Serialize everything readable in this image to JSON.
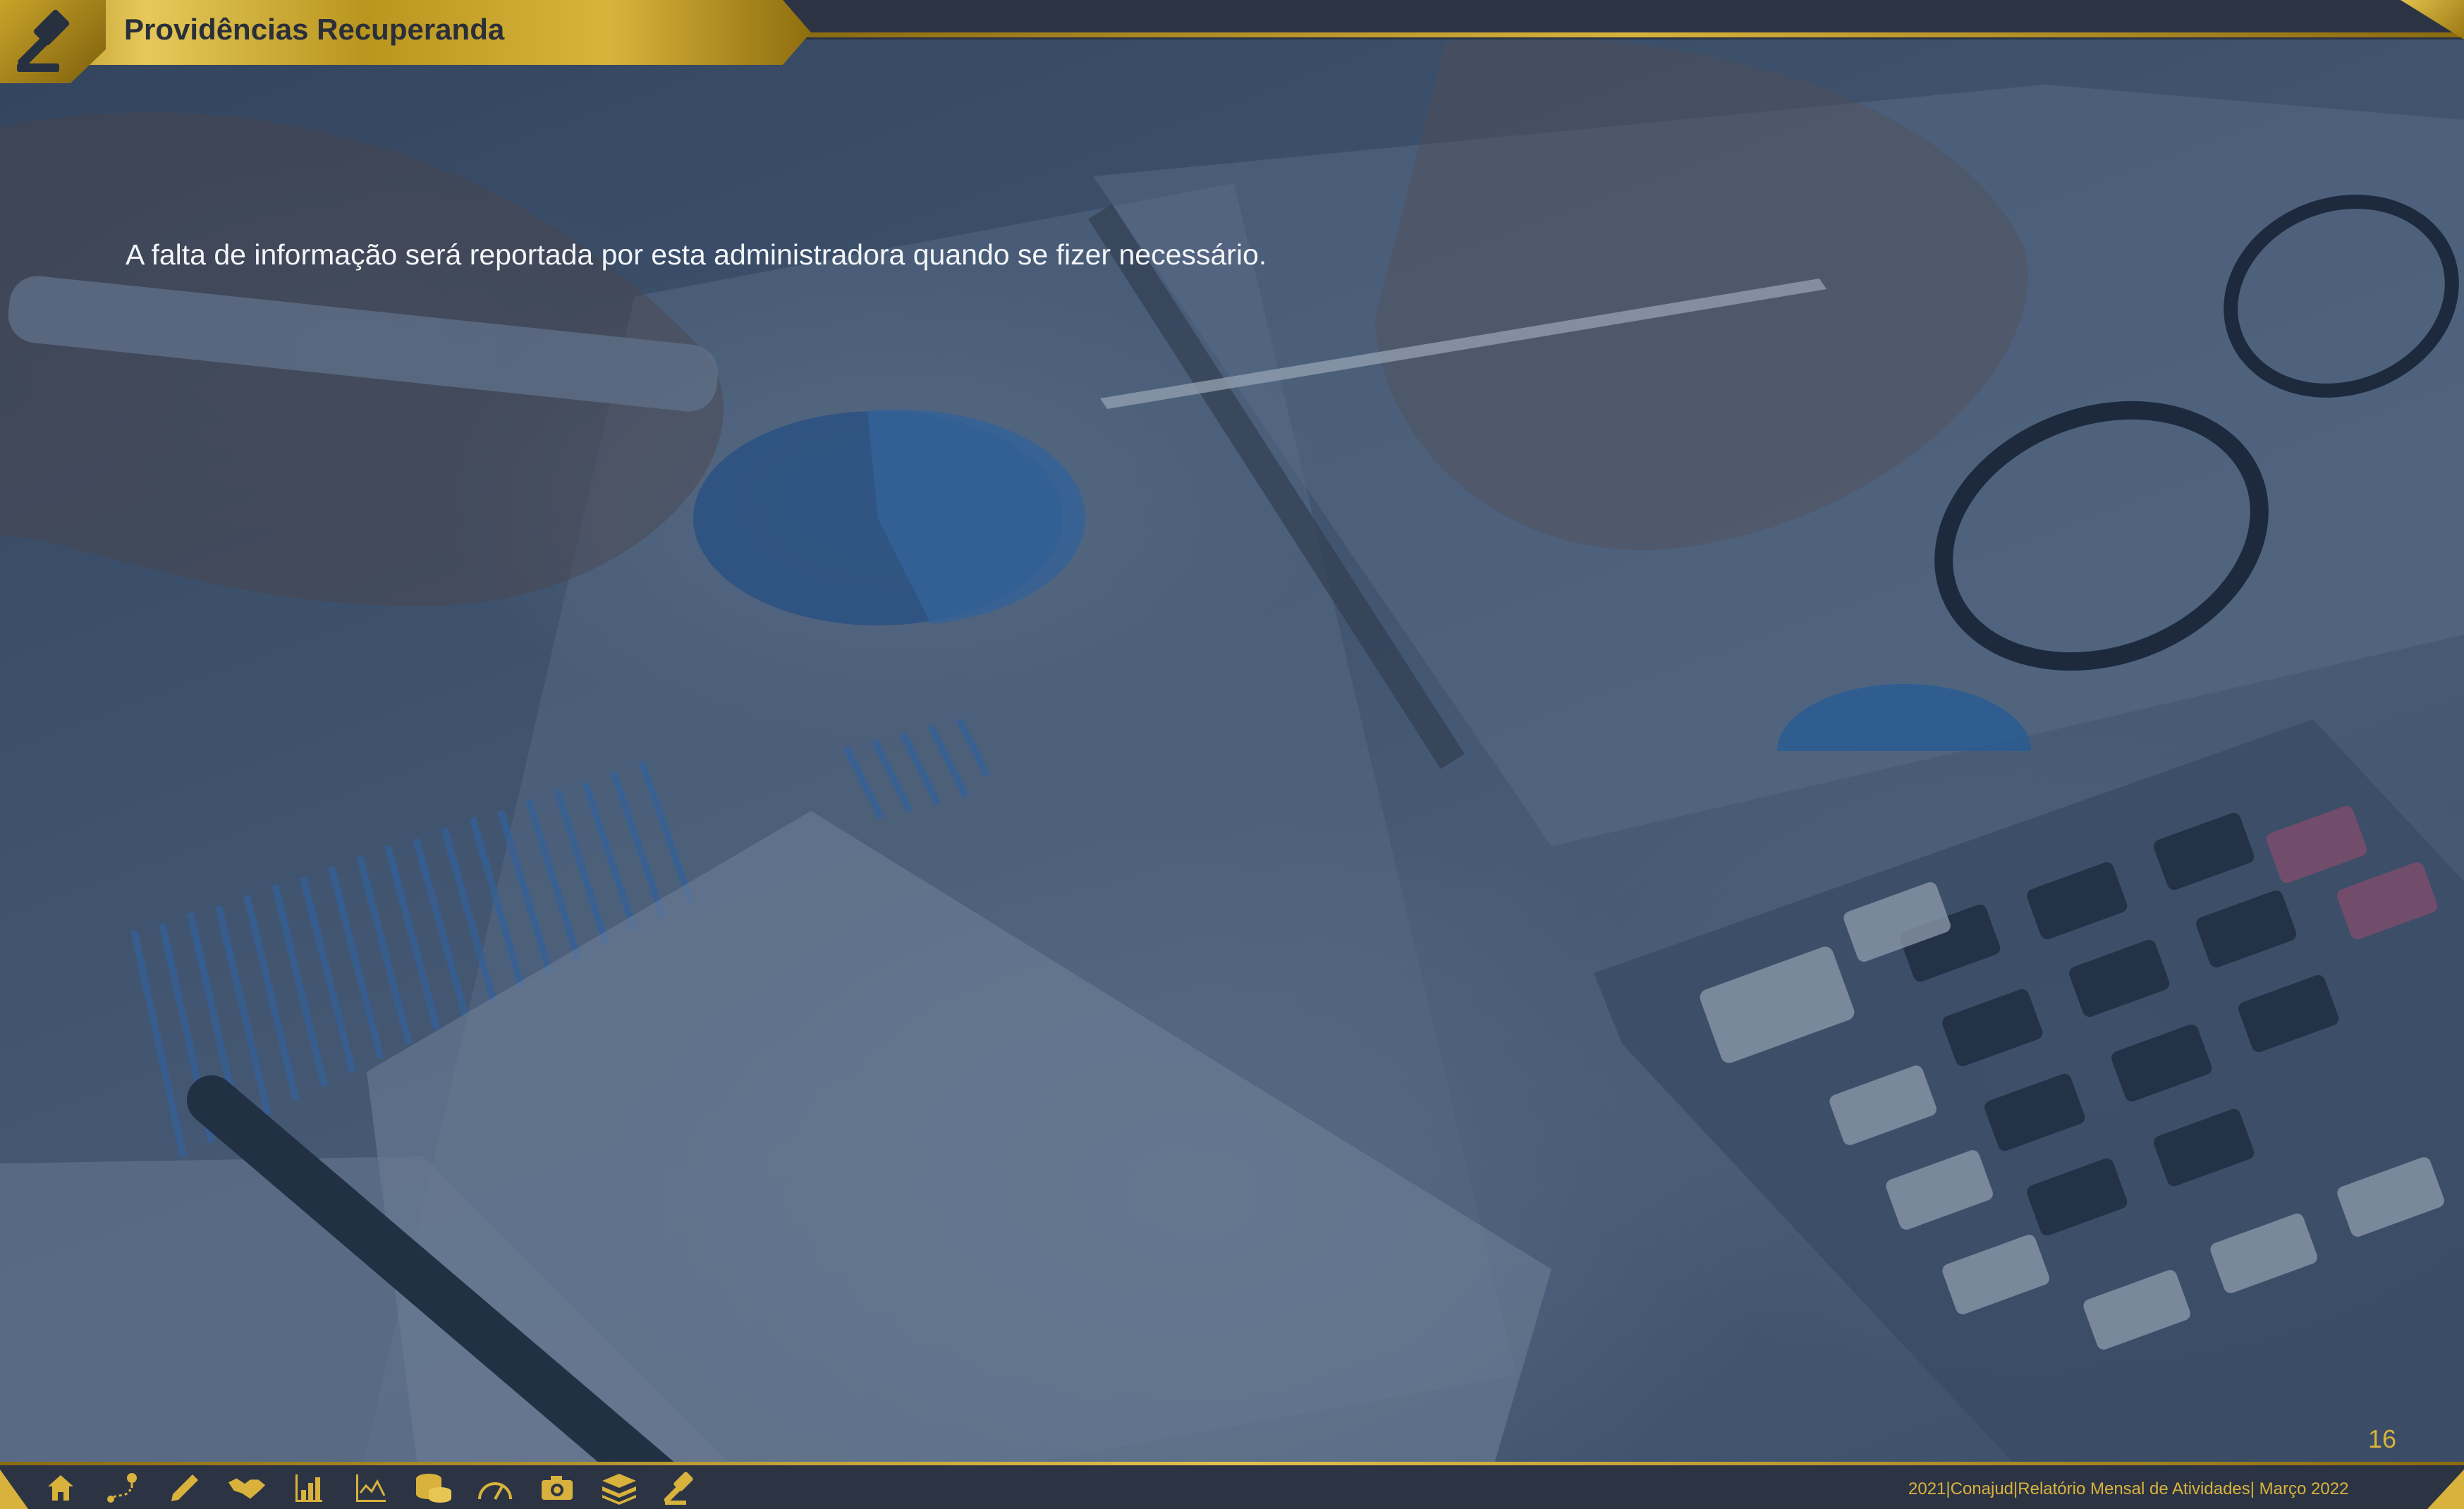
{
  "header": {
    "title": "Providências Recuperanda"
  },
  "main": {
    "text": "A falta de informação será reportada por esta administradora quando se fizer necessário."
  },
  "page_number": "16",
  "footer": {
    "text": "2021|Conajud|Relatório Mensal de Atividades| Março 2022"
  },
  "nav_icons": [
    "home-icon",
    "route-icon",
    "pencil-icon",
    "handshake-icon",
    "bar-chart-icon",
    "line-chart-icon",
    "coins-icon",
    "gauge-icon",
    "camera-icon",
    "stack-icon",
    "gavel-icon"
  ],
  "colors": {
    "accent_gold": "#d8b23c",
    "bar_dark": "#2c3444",
    "body_text": "#f2f4f7"
  }
}
